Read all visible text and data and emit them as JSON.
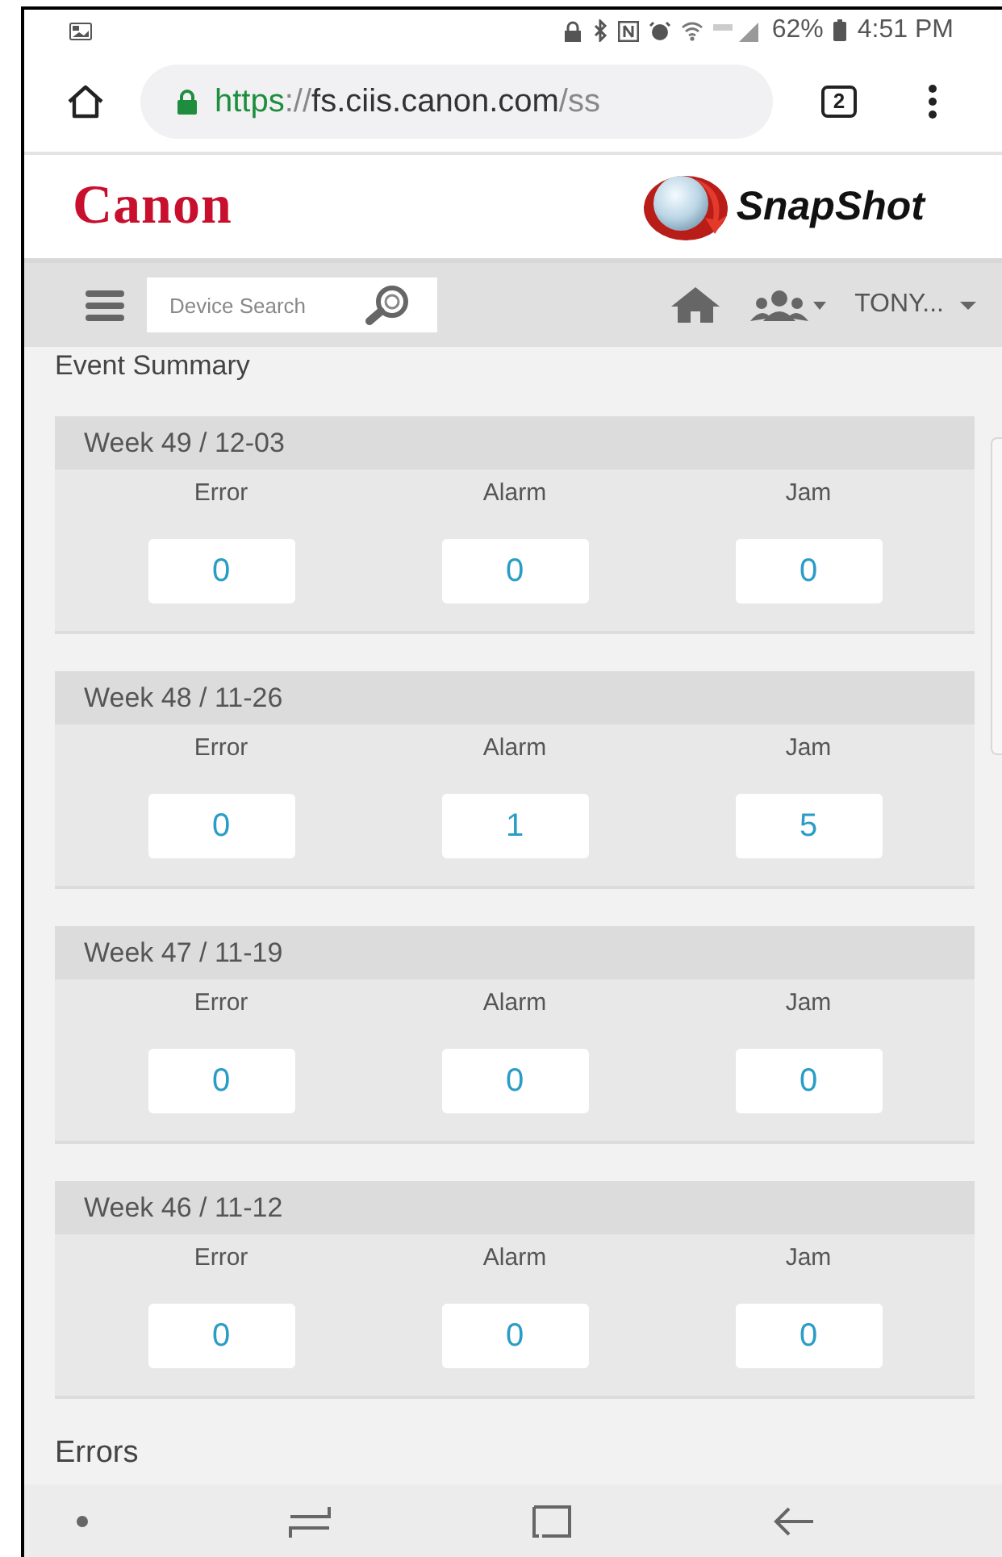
{
  "status_bar": {
    "battery": "62%",
    "time": "4:51 PM"
  },
  "browser": {
    "url": {
      "scheme": "https",
      "separator": "://",
      "host": "fs.ciis.canon.com",
      "path": "/ss"
    },
    "tab_count": "2"
  },
  "header": {
    "logo": "Canon",
    "product": "SnapShot"
  },
  "nav": {
    "search": {
      "placeholder": "Device Search"
    },
    "user": "TONY..."
  },
  "section_title": "Event Summary",
  "weeks": [
    {
      "title": "Week 49 / 12-03",
      "metrics": [
        {
          "label": "Error",
          "value": "0"
        },
        {
          "label": "Alarm",
          "value": "0"
        },
        {
          "label": "Jam",
          "value": "0"
        }
      ]
    },
    {
      "title": "Week 48 / 11-26",
      "metrics": [
        {
          "label": "Error",
          "value": "0"
        },
        {
          "label": "Alarm",
          "value": "1"
        },
        {
          "label": "Jam",
          "value": "5"
        }
      ]
    },
    {
      "title": "Week 47 / 11-19",
      "metrics": [
        {
          "label": "Error",
          "value": "0"
        },
        {
          "label": "Alarm",
          "value": "0"
        },
        {
          "label": "Jam",
          "value": "0"
        }
      ]
    },
    {
      "title": "Week 46 / 11-12",
      "metrics": [
        {
          "label": "Error",
          "value": "0"
        },
        {
          "label": "Alarm",
          "value": "0"
        },
        {
          "label": "Jam",
          "value": "0"
        }
      ]
    }
  ],
  "next_section": "Errors"
}
